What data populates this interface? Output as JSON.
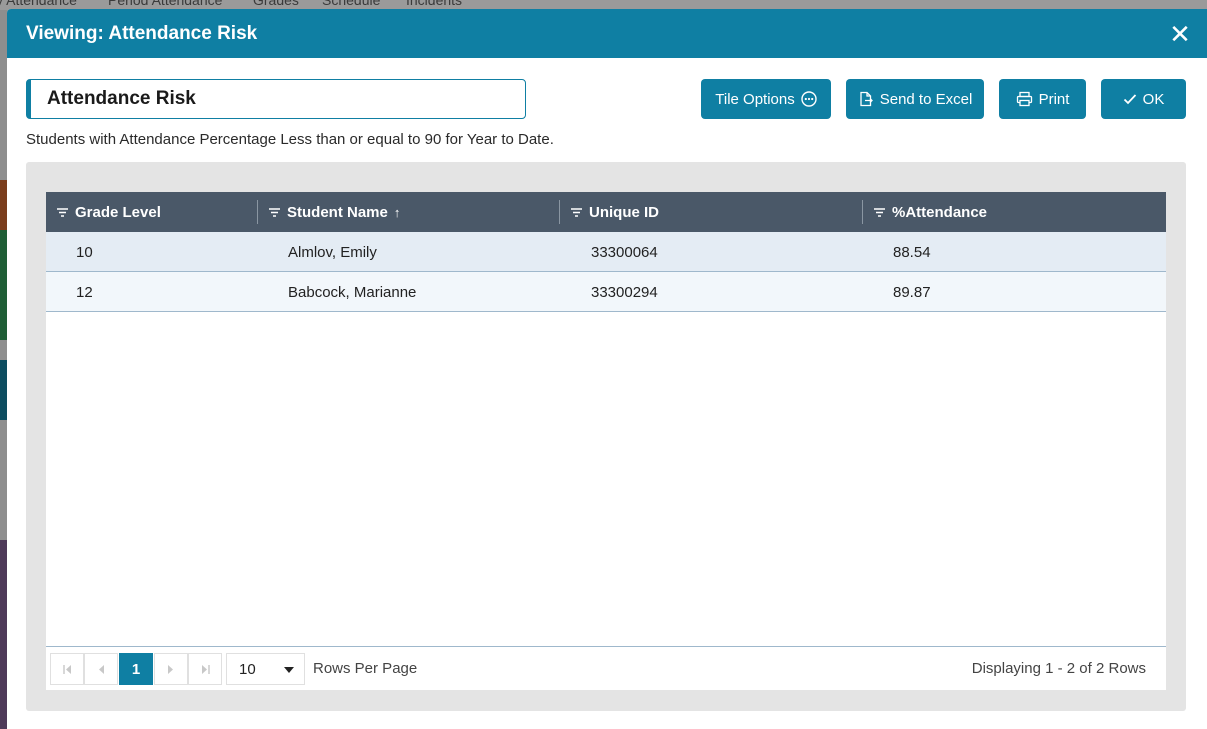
{
  "background": {
    "nav": [
      "y Attendance",
      "Period Attendance",
      "Grades",
      "Schedule",
      "Incidents"
    ]
  },
  "modal": {
    "title": "Viewing: Attendance Risk",
    "close_icon": "close-icon"
  },
  "tile": {
    "name": "Attendance Risk",
    "description": "Students with Attendance Percentage Less than or equal to 90 for Year to Date."
  },
  "toolbar": {
    "tile_options": "Tile Options",
    "send_to_excel": "Send to Excel",
    "print": "Print",
    "ok": "OK"
  },
  "grid": {
    "columns": [
      {
        "label": "Grade Level",
        "sort": ""
      },
      {
        "label": "Student Name",
        "sort": "↑"
      },
      {
        "label": "Unique ID",
        "sort": ""
      },
      {
        "label": "%Attendance",
        "sort": ""
      }
    ],
    "rows": [
      {
        "grade": "10",
        "name": "Almlov, Emily",
        "id": "33300064",
        "attendance": "88.54"
      },
      {
        "grade": "12",
        "name": "Babcock, Marianne",
        "id": "33300294",
        "attendance": "89.87"
      }
    ]
  },
  "pager": {
    "current_page": "1",
    "page_size": "10",
    "rows_per_page_label": "Rows Per Page",
    "display_info": "Displaying 1 - 2 of 2 Rows"
  },
  "colors": {
    "primary": "#0f7fa3",
    "header": "#4a5868"
  }
}
